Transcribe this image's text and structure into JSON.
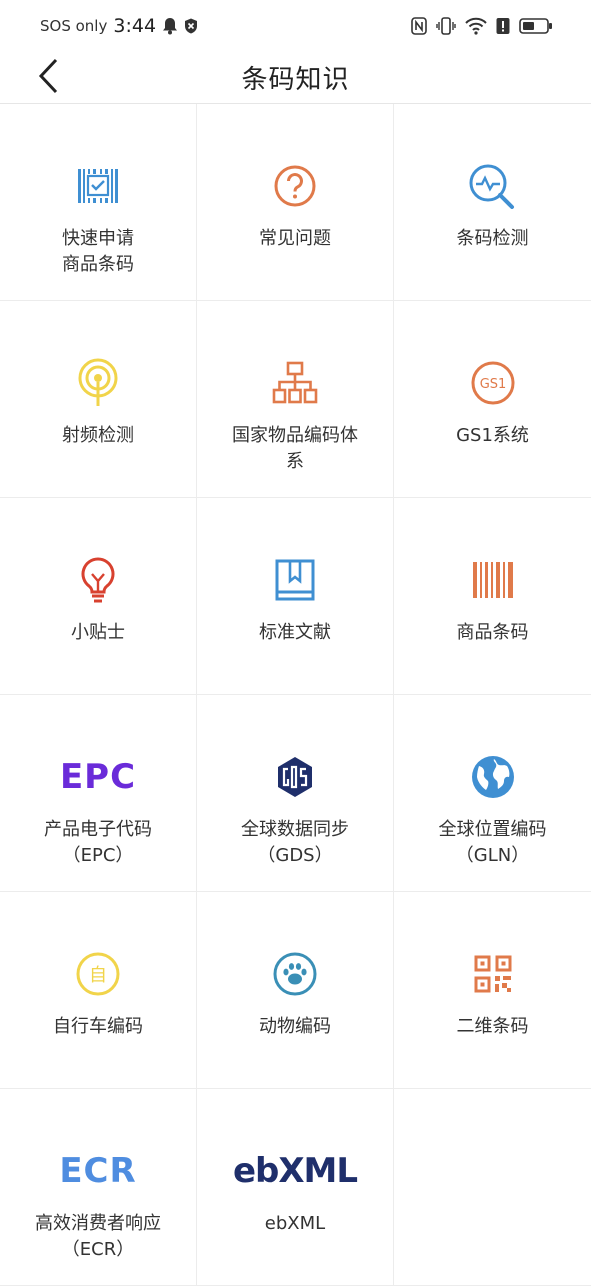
{
  "status_bar": {
    "carrier": "SOS only",
    "time": "3:44"
  },
  "header": {
    "title": "条码知识"
  },
  "grid": [
    {
      "label": "快速申请\n商品条码",
      "icon": "barcode-check-icon"
    },
    {
      "label": "常见问题",
      "icon": "question-circle-icon"
    },
    {
      "label": "条码检测",
      "icon": "search-pulse-icon"
    },
    {
      "label": "射频检测",
      "icon": "rfid-signal-icon"
    },
    {
      "label": "国家物品编码体\n系",
      "icon": "org-chart-icon"
    },
    {
      "label": "GS1系统",
      "icon": "gs1-badge-icon",
      "badge_text": "GS1"
    },
    {
      "label": "小贴士",
      "icon": "lightbulb-icon"
    },
    {
      "label": "标准文献",
      "icon": "bookmark-book-icon"
    },
    {
      "label": "商品条码",
      "icon": "barcode-icon"
    },
    {
      "label": "产品电子代码\n（EPC）",
      "icon": "epc-logo-icon",
      "logo_text": "EPC"
    },
    {
      "label": "全球数据同步\n（GDS）",
      "icon": "gds-logo-icon"
    },
    {
      "label": "全球位置编码\n（GLN）",
      "icon": "globe-icon"
    },
    {
      "label": "自行车编码",
      "icon": "bicycle-zi-icon",
      "badge_text": "自"
    },
    {
      "label": "动物编码",
      "icon": "paw-icon"
    },
    {
      "label": "二维条码",
      "icon": "qr-code-icon"
    },
    {
      "label": "高效消费者响应\n（ECR）",
      "icon": "ecr-logo-icon",
      "logo_text": "ECR"
    },
    {
      "label": "ebXML",
      "icon": "ebxml-logo-icon",
      "logo_text": "ebXML"
    },
    {
      "label": "",
      "icon": ""
    }
  ],
  "colors": {
    "blue": "#3f8fd2",
    "orange": "#e07a4a",
    "yellow": "#f1d44a",
    "red": "#d8412f",
    "purple": "#6a2bd9",
    "navy": "#1f2f6b",
    "ecr_blue": "#4f8de0"
  }
}
